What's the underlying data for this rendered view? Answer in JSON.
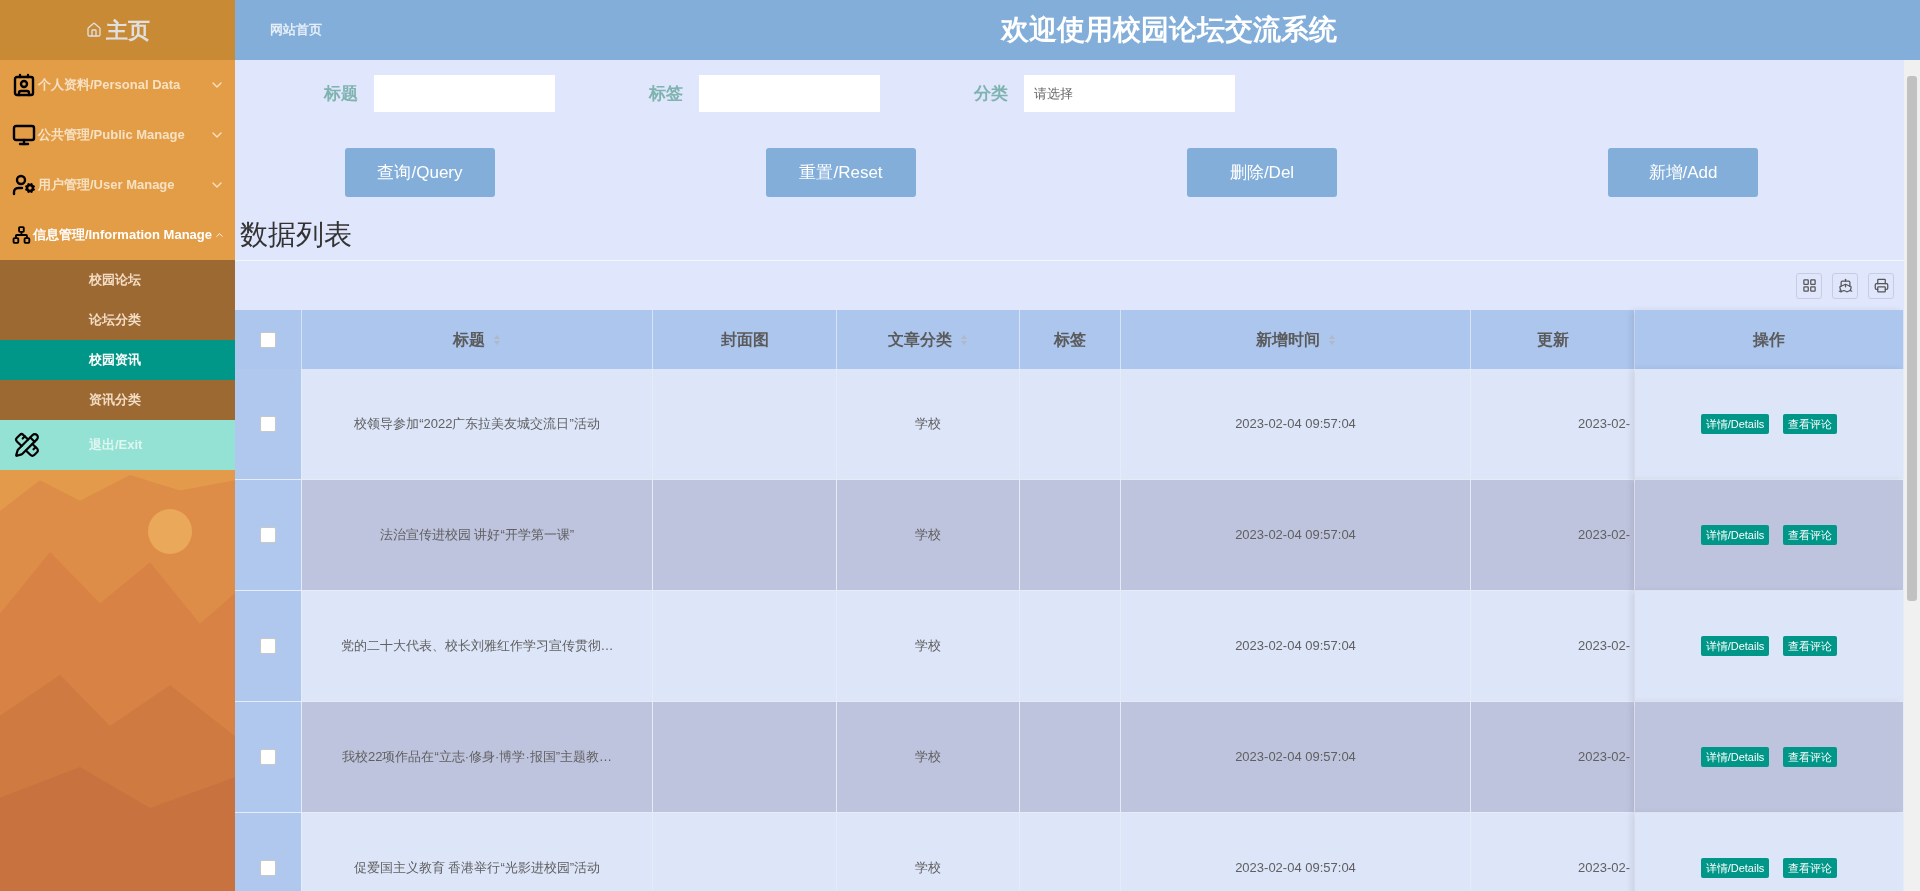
{
  "sidebar": {
    "home": "主页",
    "menus": [
      {
        "label": "个人资料/Personal Data",
        "expanded": false
      },
      {
        "label": "公共管理/Public Manage",
        "expanded": false
      },
      {
        "label": "用户管理/User Manage",
        "expanded": false
      },
      {
        "label": "信息管理/Information Manage",
        "expanded": true,
        "children": [
          {
            "label": "校园论坛",
            "selected": false
          },
          {
            "label": "论坛分类",
            "selected": false
          },
          {
            "label": "校园资讯",
            "selected": true
          },
          {
            "label": "资讯分类",
            "selected": false
          }
        ]
      }
    ],
    "exit": "退出/Exit"
  },
  "header": {
    "breadcrumb": "网站首页",
    "title": "欢迎使用校园论坛交流系统"
  },
  "filters": [
    {
      "label": "标题"
    },
    {
      "label": "标签"
    },
    {
      "label": "分类",
      "placeholder": "请选择"
    }
  ],
  "buttons": [
    "查询/Query",
    "重置/Reset",
    "删除/Del",
    "新增/Add"
  ],
  "section_title": "数据列表",
  "table": {
    "select_all": {
      "checked": false
    },
    "columns": [
      {
        "label": "标题",
        "sortable": true
      },
      {
        "label": "封面图",
        "sortable": false
      },
      {
        "label": "文章分类",
        "sortable": true
      },
      {
        "label": "标签",
        "sortable": false
      },
      {
        "label": "新增时间",
        "sortable": true
      },
      {
        "label": "更新",
        "sortable": false
      },
      {
        "label": "操作",
        "sortable": false
      }
    ],
    "rows": [
      {
        "checked": false,
        "title": "校领导参加“2022广东拉美友城交流日”活动",
        "category": "学校",
        "add_time": "2023-02-04 09:57:04",
        "update_time": "2023-02-",
        "actions": [
          "详情/Details",
          "查看评论"
        ]
      },
      {
        "checked": false,
        "title": "法治宣传进校园 讲好“开学第一课”",
        "category": "学校",
        "add_time": "2023-02-04 09:57:04",
        "update_time": "2023-02-",
        "actions": [
          "详情/Details",
          "查看评论"
        ]
      },
      {
        "checked": false,
        "title": "党的二十大代表、校长刘雅红作学习宣传贯彻…",
        "category": "学校",
        "add_time": "2023-02-04 09:57:04",
        "update_time": "2023-02-",
        "actions": [
          "详情/Details",
          "查看评论"
        ]
      },
      {
        "checked": false,
        "title": "我校22项作品在“立志·修身·博学·报国”主题教…",
        "category": "学校",
        "add_time": "2023-02-04 09:57:04",
        "update_time": "2023-02-",
        "actions": [
          "详情/Details",
          "查看评论"
        ]
      },
      {
        "checked": false,
        "title": "促爱国主义教育 香港举行“光影进校园”活动",
        "category": "学校",
        "add_time": "2023-02-04 09:57:04",
        "update_time": "2023-02-",
        "actions": [
          "详情/Details",
          "查看评论"
        ]
      }
    ]
  }
}
